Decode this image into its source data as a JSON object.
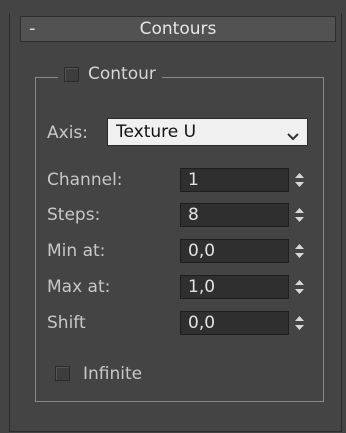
{
  "rollout": {
    "collapse_symbol": "-",
    "title": "Contours"
  },
  "group": {
    "label": "Contour",
    "checked": false
  },
  "axis": {
    "label": "Axis:",
    "value": "Texture U"
  },
  "params": [
    {
      "label": "Channel:",
      "value": "1"
    },
    {
      "label": "Steps:",
      "value": "8"
    },
    {
      "label": "Min at:",
      "value": "0,0"
    },
    {
      "label": "Max at:",
      "value": "1,0"
    },
    {
      "label": "Shift",
      "value": "0,0"
    }
  ],
  "infinite": {
    "label": "Infinite",
    "checked": false
  },
  "colors": {
    "background": "#444444",
    "field": "#2f2f2f",
    "dropdown": "#f0f0f0"
  },
  "icons": {
    "dropdown": "chevron-down-icon",
    "spinner": "spinner-icon"
  }
}
